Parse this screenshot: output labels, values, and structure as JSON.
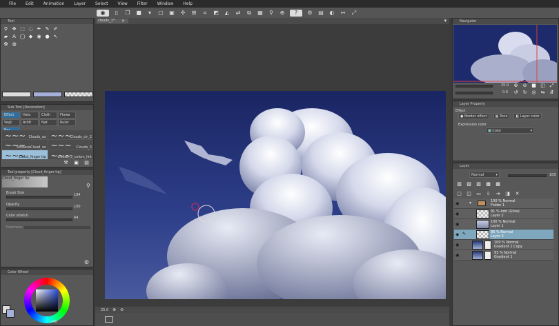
{
  "menu": [
    "File",
    "Edit",
    "Animation",
    "Layer",
    "Select",
    "View",
    "Filter",
    "Window",
    "Help"
  ],
  "toolbar_icons": [
    "eye-icon",
    "new-file-icon",
    "copy-icon",
    "save-icon",
    "chevron-down-icon",
    "undo-icon",
    "redo-icon",
    "move-icon",
    "grid-icon",
    "crop-icon",
    "eraser-icon",
    "fill-icon",
    "transform-icon",
    "flip-icon",
    "color-icon",
    "magnifier-icon",
    "zoom-icon",
    "info-icon",
    "settings-icon",
    "layers-icon",
    "palette-icon",
    "arrows-icon",
    "expand-icon"
  ],
  "tool_panel": {
    "tab": "Tool"
  },
  "sub_tool": {
    "title": "Sub Tool [Decoration]",
    "tabs": [
      "Effect",
      "Hatc",
      "Cloth",
      "Flowe",
      "Vegt",
      "Artifi",
      "Nat",
      "Ruler",
      "Bac"
    ],
    "brushes": [
      "Clouds_so",
      "Clouds_cir_2",
      "SmeaceCloud_so",
      "Clouds_3",
      "Cloud_finger tip",
      "clouds_3_colors_lint"
    ]
  },
  "tool_property": {
    "title": "Tool property [Cloud_finger tip]",
    "brush_name": "Cloud_finger tip",
    "brush_size_label": "Brush Size",
    "brush_size_value": "194",
    "opacity_label": "Opacity",
    "opacity_value": "100",
    "color_stretch_label": "Color stretch",
    "color_stretch_value": "64",
    "hardness_label": "Hardness"
  },
  "color_wheel": {
    "title": "Color Wheel",
    "value": "248"
  },
  "canvas": {
    "tab": "clouds_1*",
    "zoom": "25.0"
  },
  "navigator": {
    "tab": "Navigator",
    "zoom": "25.0",
    "angle": "0.0"
  },
  "layer_property": {
    "tab": "Layer Property",
    "section": "Effect",
    "border_effect": "Border effect",
    "tone": "Tone",
    "layer_color": "Layer color",
    "expression_label": "Expression color",
    "expression_value": "Color"
  },
  "layers_panel": {
    "tab": "Layer",
    "blend_mode": "Normal",
    "opacity": "100",
    "layers": [
      {
        "line1": "100 % Normal",
        "line2": "Folder 1",
        "thumb": "folder"
      },
      {
        "line1": "91 % Add (Glow)",
        "line2": "Layer 2",
        "thumb": "checker"
      },
      {
        "line1": "100 % Normal",
        "line2": "Layer 1",
        "thumb": "cloud"
      },
      {
        "line1": "86 % Normal",
        "line2": "Layer 3",
        "thumb": "checker",
        "selected": true
      },
      {
        "line1": "100 % Normal",
        "line2": "Gradient 1 Copy",
        "thumb": "sky"
      },
      {
        "line1": "93 % Normal",
        "line2": "Gradient 1",
        "thumb": "sky"
      }
    ]
  },
  "colors": {
    "accent": "#2f6f9f",
    "selected_layer": "#7fa7bd",
    "sky": "#1c2a6e"
  }
}
